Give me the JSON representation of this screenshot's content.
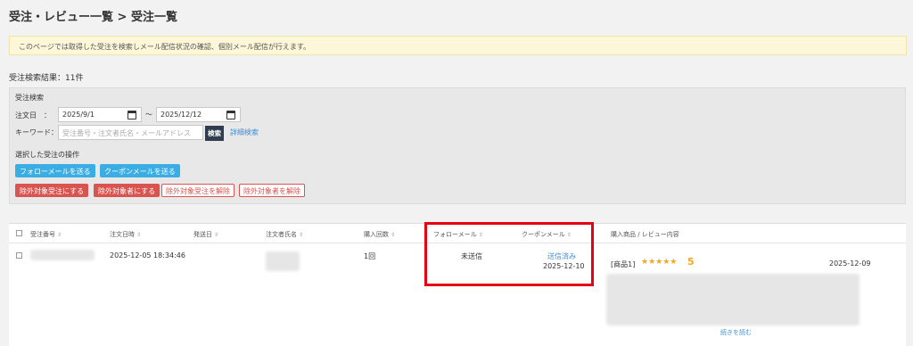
{
  "page": {
    "title": "受注・レビュー一覧 > 受注一覧",
    "notice": "このページでは取得した受注を検索しメール配信状況の確認、個別メール配信が行えます。",
    "result_count": "受注検索結果：11件"
  },
  "search": {
    "heading": "受注検索",
    "order_date_label": "注文日　：",
    "date_from": "2025/9/1",
    "range_sep": "〜",
    "date_to": "2025/12/12",
    "keyword_label": "キーワード：",
    "keyword_placeholder": "受注番号・注文者氏名・メールアドレス",
    "search_button": "検索",
    "advanced_link": "詳細検索"
  },
  "actions": {
    "heading": "選択した受注の操作",
    "follow_mail": "フォローメールを送る",
    "coupon_mail": "クーポンメールを送る",
    "exclude_order": "除外対象受注にする",
    "exclude_customer": "除外対象者にする",
    "unexclude_order": "除外対象受注を解除",
    "unexclude_customer": "除外対象者を解除"
  },
  "table": {
    "columns": [
      "受注番号",
      "注文日時",
      "発送日",
      "注文者氏名",
      "購入回数",
      "フォローメール",
      "クーポンメール",
      "購入商品 / レビュー内容"
    ],
    "sort_glyph": "⇕",
    "rows": [
      {
        "order_datetime": "2025-12-05 18:34:46",
        "purchase_count": "1回",
        "follow_status": "未送信",
        "coupon_status": "送信済み",
        "coupon_date": "2025-12-10",
        "product_tag": "[商品1]",
        "stars": "★★★★★",
        "score": "5",
        "review_date": "2025-12-09",
        "read_more": "続きを読む"
      }
    ]
  },
  "colors": {
    "highlight": "#e50012",
    "primary_blue": "#3aaee4",
    "danger_red": "#d9534f",
    "star": "#f5a623"
  }
}
